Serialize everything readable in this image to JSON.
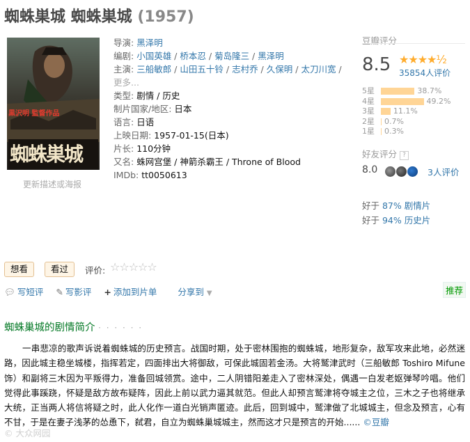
{
  "title": {
    "name": "蜘蛛巣城 蜘蛛巣城",
    "year": "(1957)"
  },
  "poster": {
    "edit_label": "更新描述或海报",
    "poster_text": "蜘蛛巣城",
    "credit_text": "黒沢明 監督作品"
  },
  "info": {
    "director_label": "导演: ",
    "directors": [
      "黑泽明"
    ],
    "writer_label": "编剧: ",
    "writers": [
      "小国英雄",
      "桥本忍",
      "菊岛隆三",
      "黑泽明"
    ],
    "cast_label": "主演: ",
    "cast": [
      "三船敏郎",
      "山田五十铃",
      "志村乔",
      "久保明",
      "太刀川宽"
    ],
    "more_label": "更多...",
    "genre_label": "类型: ",
    "genres": "剧情 / 历史",
    "country_label": "制片国家/地区: ",
    "country": "日本",
    "language_label": "语言: ",
    "language": "日语",
    "release_label": "上映日期: ",
    "release": "1957-01-15(日本)",
    "runtime_label": "片长: ",
    "runtime": "110分钟",
    "aka_label": "又名: ",
    "aka": "蛛网宫堡 / 神箭杀霸王 / Throne of Blood",
    "imdb_label": "IMDb: ",
    "imdb": "tt0050613"
  },
  "rating": {
    "title": "豆瓣评分",
    "score": "8.5",
    "stars": "★★★★½",
    "votes": "35854人评价",
    "distribution": [
      {
        "label": "5星",
        "percent": 38.7,
        "text": "38.7%"
      },
      {
        "label": "4星",
        "percent": 49.2,
        "text": "49.2%"
      },
      {
        "label": "3星",
        "percent": 11.1,
        "text": "11.1%"
      },
      {
        "label": "2星",
        "percent": 0.7,
        "text": "0.7%"
      },
      {
        "label": "1星",
        "percent": 0.3,
        "text": "0.3%"
      }
    ]
  },
  "friend_rating": {
    "title": "好友评分",
    "help": "?",
    "score": "8.0",
    "count": "3人评价"
  },
  "better_than": [
    {
      "prefix": "好于 ",
      "percent": "87%",
      "genre": "剧情片"
    },
    {
      "prefix": "好于 ",
      "percent": "94%",
      "genre": "历史片"
    }
  ],
  "buttons": {
    "want": "想看",
    "seen": "看过",
    "rate_label": "评价:",
    "rate_stars": "☆☆☆☆☆"
  },
  "actions": {
    "short_review": "写短评",
    "review": "写影评",
    "add_list": "添加到片单",
    "share": "分享到",
    "recommend": "推荐"
  },
  "summary": {
    "title": "蜘蛛巢城的剧情简介",
    "dots": "· · · · · ·",
    "text": "一串悲凉的歌声诉说着蜘蛛城的历史预言。战国时期，处于密林围抱的蜘蛛城，地形复杂，敌军攻来此地，必然迷路，因此城主稳坐城楼，指挥若定，四面排出大将御敌，可保此城固若金汤。大将鹫津武时（三船敏郎 Toshiro Mifune 饰）和副将三木因为平叛得力，准备回城领赏。途中，二人阴错阳差走入了密林深处，偶遇一白发老妪弹琴吟唱。他们觉得此事蹊跷，怀疑是敌方故布疑阵，因此上前以武力逼其就范。但此人却预言鹫津将夺城主之位，三木之子也将继承大统，正当两人将信将疑之时，此人化作一道白光销声匿迹。此后，回到城中，鹫津做了北城城主，但念及预言，心有不甘，于是在妻子浅茅的怂恿下，弑君，自立为蜘蛛巢城城主，然而这才只是预言的开始......",
    "credit": "©豆瓣"
  },
  "watermark": "© 大众网园"
}
